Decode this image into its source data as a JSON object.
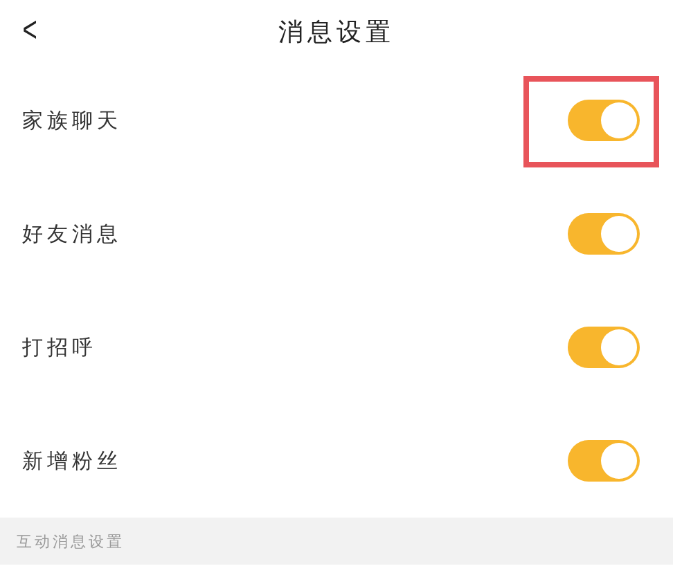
{
  "header": {
    "back": "<",
    "title": "消息设置"
  },
  "settings": [
    {
      "label": "家族聊天",
      "on": true,
      "highlighted": true
    },
    {
      "label": "好友消息",
      "on": true,
      "highlighted": false
    },
    {
      "label": "打招呼",
      "on": true,
      "highlighted": false
    },
    {
      "label": "新增粉丝",
      "on": true,
      "highlighted": false
    }
  ],
  "section": {
    "title": "互动消息设置"
  }
}
